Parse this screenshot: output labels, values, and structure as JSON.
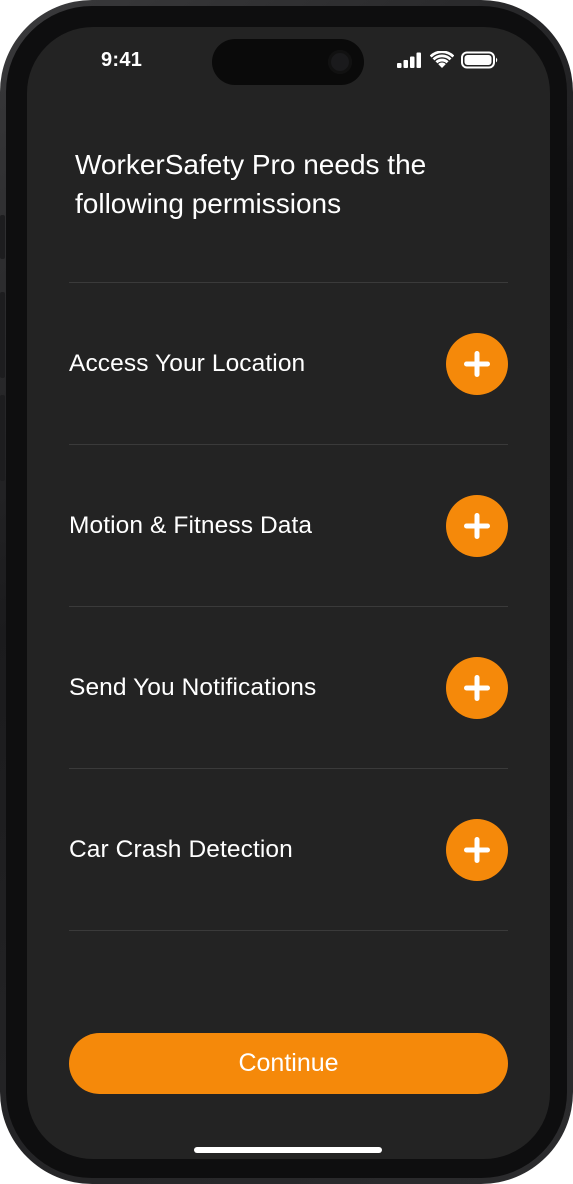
{
  "status_bar": {
    "time": "9:41",
    "icons": [
      "cellular-signal-icon",
      "wifi-icon",
      "battery-icon"
    ]
  },
  "header": {
    "title": "WorkerSafety Pro needs the following permissions"
  },
  "permissions": [
    {
      "label": "Access Your Location",
      "action_icon": "plus-icon"
    },
    {
      "label": "Motion & Fitness Data",
      "action_icon": "plus-icon"
    },
    {
      "label": "Send You Notifications",
      "action_icon": "plus-icon"
    },
    {
      "label": "Car Crash Detection",
      "action_icon": "plus-icon"
    }
  ],
  "continue_button": {
    "label": "Continue"
  },
  "colors": {
    "accent": "#f5890a",
    "background": "#232323",
    "divider": "#3a3a3a",
    "text": "#ffffff"
  }
}
